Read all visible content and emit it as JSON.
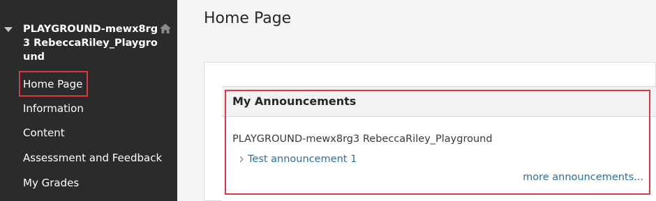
{
  "sidebar": {
    "course_title": "PLAYGROUND-mewx8rg3 RebeccaRiley_Playground",
    "items": [
      {
        "label": "Home Page"
      },
      {
        "label": "Information"
      },
      {
        "label": "Content"
      },
      {
        "label": "Assessment and Feedback"
      },
      {
        "label": "My Grades"
      }
    ],
    "icons": {
      "collapse": "triangle-down-icon",
      "home": "home-icon"
    }
  },
  "main": {
    "page_title": "Home Page",
    "module": {
      "title": "My Announcements",
      "course": "PLAYGROUND-mewx8rg3 RebeccaRiley_Playground",
      "announcements": [
        {
          "label": "Test announcement 1"
        }
      ],
      "more_link": "more announcements..."
    }
  },
  "colors": {
    "sidebar_bg": "#2b2b2b",
    "main_bg": "#f5f5f5",
    "link": "#2c6fa3",
    "highlight": "#e0383e"
  }
}
